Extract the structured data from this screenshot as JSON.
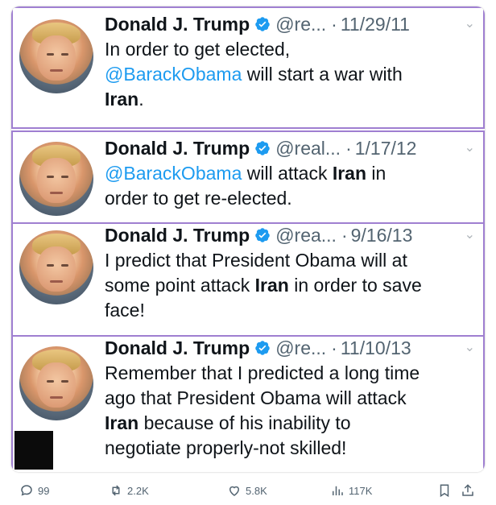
{
  "tweets": [
    {
      "name": "Donald J. Trump",
      "handle": "@re...",
      "date": "11/29/11",
      "text": [
        {
          "t": "In order to get elected,",
          "s": "plain",
          "br": true
        },
        {
          "t": "@BarackObama",
          "s": "mention"
        },
        {
          "t": " will start a war with",
          "s": "plain",
          "br": true
        },
        {
          "t": "Iran",
          "s": "bold"
        },
        {
          "t": ".",
          "s": "plain"
        }
      ]
    },
    {
      "name": "Donald J. Trump",
      "handle": "@real...",
      "date": "1/17/12",
      "text": [
        {
          "t": "@BarackObama",
          "s": "mention"
        },
        {
          "t": " will attack ",
          "s": "plain"
        },
        {
          "t": "Iran",
          "s": "bold"
        },
        {
          "t": " in",
          "s": "plain",
          "br": true
        },
        {
          "t": "order to get re-elected.",
          "s": "plain"
        }
      ]
    },
    {
      "name": "Donald J. Trump",
      "handle": "@rea...",
      "date": "9/16/13",
      "text": [
        {
          "t": "I predict that President Obama will at",
          "s": "plain",
          "br": true
        },
        {
          "t": "some point attack ",
          "s": "plain"
        },
        {
          "t": "Iran",
          "s": "bold"
        },
        {
          "t": " in order to save",
          "s": "plain",
          "br": true
        },
        {
          "t": "face!",
          "s": "plain"
        }
      ]
    },
    {
      "name": "Donald J. Trump",
      "handle": "@re...",
      "date": "11/10/13",
      "text": [
        {
          "t": "Remember that I predicted a long time",
          "s": "plain",
          "br": true
        },
        {
          "t": "ago that President Obama will attack",
          "s": "plain",
          "br": true
        },
        {
          "t": "Iran",
          "s": "bold"
        },
        {
          "t": " because of his inability to",
          "s": "plain",
          "br": true
        },
        {
          "t": "negotiate properly-not skilled!",
          "s": "plain"
        }
      ]
    }
  ],
  "dot_separator": "·",
  "actions": {
    "replies": "99",
    "reposts": "2.2K",
    "likes": "5.8K",
    "views": "117K"
  },
  "colors": {
    "mention": "#1d9bf0",
    "verified": "#1d9bf0",
    "border": "#9f7fd1",
    "muted": "#536471"
  },
  "icons": [
    "verified-badge-icon",
    "chevron-down-icon",
    "reply-icon",
    "repost-icon",
    "like-icon",
    "views-icon",
    "bookmark-icon",
    "share-icon"
  ]
}
